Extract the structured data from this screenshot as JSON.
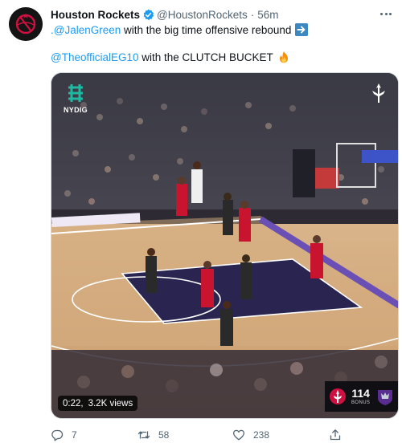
{
  "tweet": {
    "display_name": "Houston Rockets",
    "handle": "@HoustonRockets",
    "separator": "·",
    "time": "56m",
    "line1": {
      "mention": ".@JalenGreen",
      "text": " with the big time offensive rebound"
    },
    "line2": {
      "mention": "@TheofficialEG10",
      "text": " with the CLUTCH BUCKET"
    }
  },
  "media": {
    "sponsor_name": "NYDIG",
    "time_elapsed": "0:22",
    "separator": ",",
    "views": "3.2K views",
    "scorebug": {
      "score": "114",
      "bonus": "BONUS"
    }
  },
  "actions": {
    "replies": "7",
    "retweets": "58",
    "likes": "238"
  },
  "icons": {
    "avatar": "rockets-logo-icon",
    "verified": "verified-badge-icon",
    "arrow_emoji": "right-arrow-emoji-icon",
    "fire_emoji": "fire-emoji-icon",
    "reply": "reply-icon",
    "retweet": "retweet-icon",
    "like": "heart-icon",
    "share": "share-icon"
  },
  "colors": {
    "link": "#1d9bf0",
    "text": "#0f1419",
    "secondary": "#536471",
    "rockets_red": "#ce1141"
  }
}
